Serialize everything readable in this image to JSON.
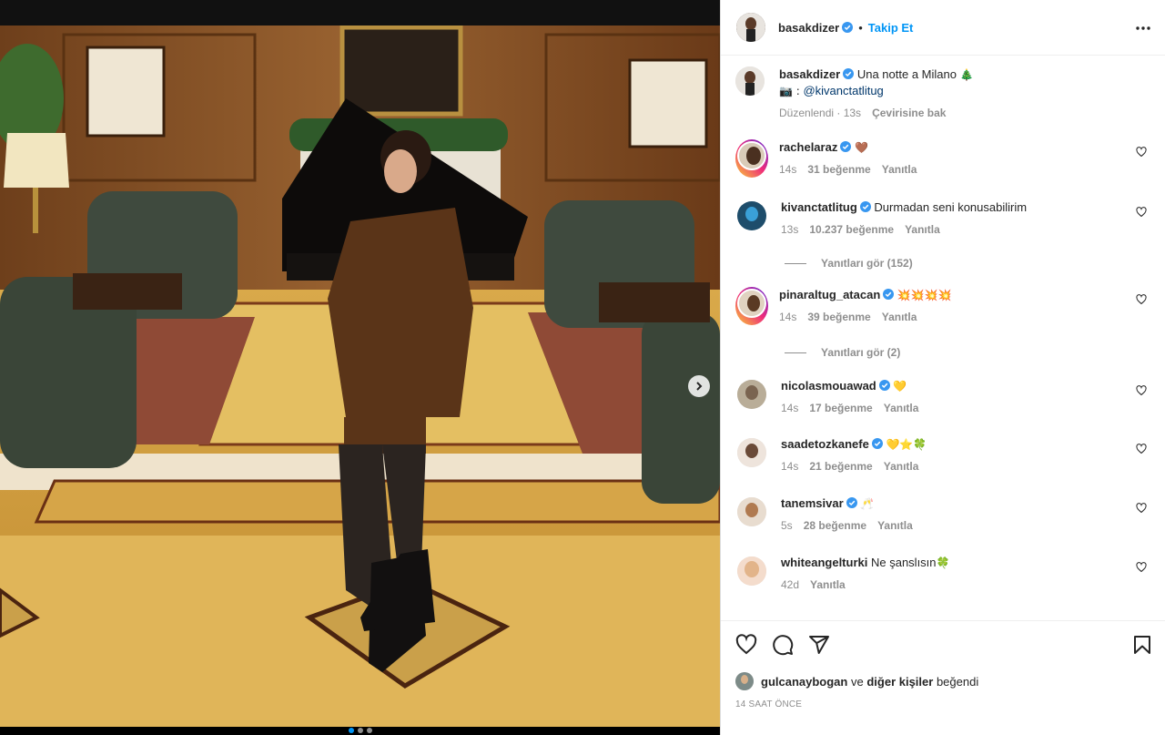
{
  "post": {
    "author": "basakdizer",
    "follow_label": "Takip Et",
    "bullet": "•",
    "caption_text": "Una notte a Milano",
    "caption_emoji": "🎄",
    "caption_camera": "📷 :",
    "caption_mention": "@kivanctatlitug",
    "edited_label": "Düzenlendi · 13s",
    "translation_label": "Çevirisine bak"
  },
  "comments": [
    {
      "user": "rachelaraz",
      "text": "",
      "emoji": "🤎",
      "time": "14s",
      "likes": "31 beğenme",
      "reply": "Yanıtla"
    },
    {
      "user": "kivanctatlitug",
      "text": "Durmadan seni konusabilirim",
      "emoji": "",
      "time": "13s",
      "likes": "10.237 beğenme",
      "reply": "Yanıtla",
      "view_replies": "Yanıtları gör (152)"
    },
    {
      "user": "pinaraltug_atacan",
      "text": "",
      "emoji": "💥💥💥💥",
      "time": "14s",
      "likes": "39 beğenme",
      "reply": "Yanıtla",
      "view_replies": "Yanıtları gör (2)"
    },
    {
      "user": "nicolasmouawad",
      "text": "",
      "emoji": "💛",
      "time": "14s",
      "likes": "17 beğenme",
      "reply": "Yanıtla"
    },
    {
      "user": "saadetozkanefe",
      "text": "",
      "emoji": "💛⭐🍀",
      "time": "14s",
      "likes": "21 beğenme",
      "reply": "Yanıtla"
    },
    {
      "user": "tanemsivar",
      "text": "",
      "emoji": "🥂",
      "time": "5s",
      "likes": "28 beğenme",
      "reply": "Yanıtla"
    },
    {
      "user": "whiteangelturki",
      "text": "Ne şanslısın",
      "emoji": "🍀",
      "time": "42d",
      "likes": "",
      "reply": "Yanıtla"
    }
  ],
  "liked_by": {
    "user": "gulcanaybogan",
    "connector": "ve",
    "others": "diğer kişiler",
    "suffix": "beğendi"
  },
  "time_ago": "14 SAAT ÖNCE",
  "colors": {
    "accent": "#0095f6",
    "verified": "#3897f0",
    "muted": "#8e8e8e"
  },
  "icons": [
    "heart-icon",
    "comment-icon",
    "share-icon",
    "bookmark-icon",
    "more-icon",
    "verified-icon",
    "chevron-right-icon"
  ]
}
